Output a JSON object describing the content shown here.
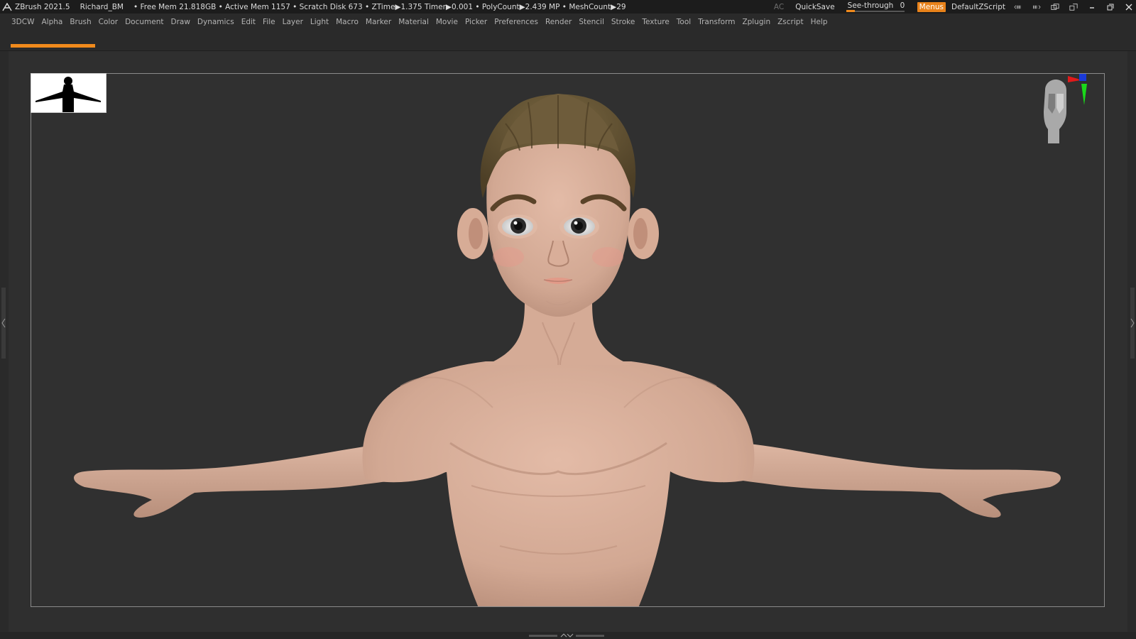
{
  "titlebar": {
    "app": "ZBrush 2021.5",
    "project": "Richard_BM",
    "stats": "• Free Mem 21.818GB • Active Mem 1157 • Scratch Disk 673 • ZTime▶1.375 Timer▶0.001 • PolyCount▶2.439 MP • MeshCount▶29",
    "ac": "AC",
    "quicksave": "QuickSave",
    "seethrough_label": "See-through",
    "seethrough_value": "0",
    "seethrough_level": 0.15,
    "menus": "Menus",
    "script": "DefaultZScript",
    "accent": "#f08a1c"
  },
  "menu": [
    "3DCW",
    "Alpha",
    "Brush",
    "Color",
    "Document",
    "Draw",
    "Dynamics",
    "Edit",
    "File",
    "Layer",
    "Light",
    "Macro",
    "Marker",
    "Material",
    "Movie",
    "Picker",
    "Preferences",
    "Render",
    "Stencil",
    "Stroke",
    "Texture",
    "Tool",
    "Transform",
    "Zplugin",
    "Zscript",
    "Help"
  ],
  "colors": {
    "skin": "#d6ad99",
    "hair": "#6b5a3a",
    "background": "#303030"
  },
  "icons": {
    "logo": "zbrush-logo-icon",
    "navcube": "head-navigation-icon",
    "thumbnail": "silhouette-thumbnail"
  }
}
